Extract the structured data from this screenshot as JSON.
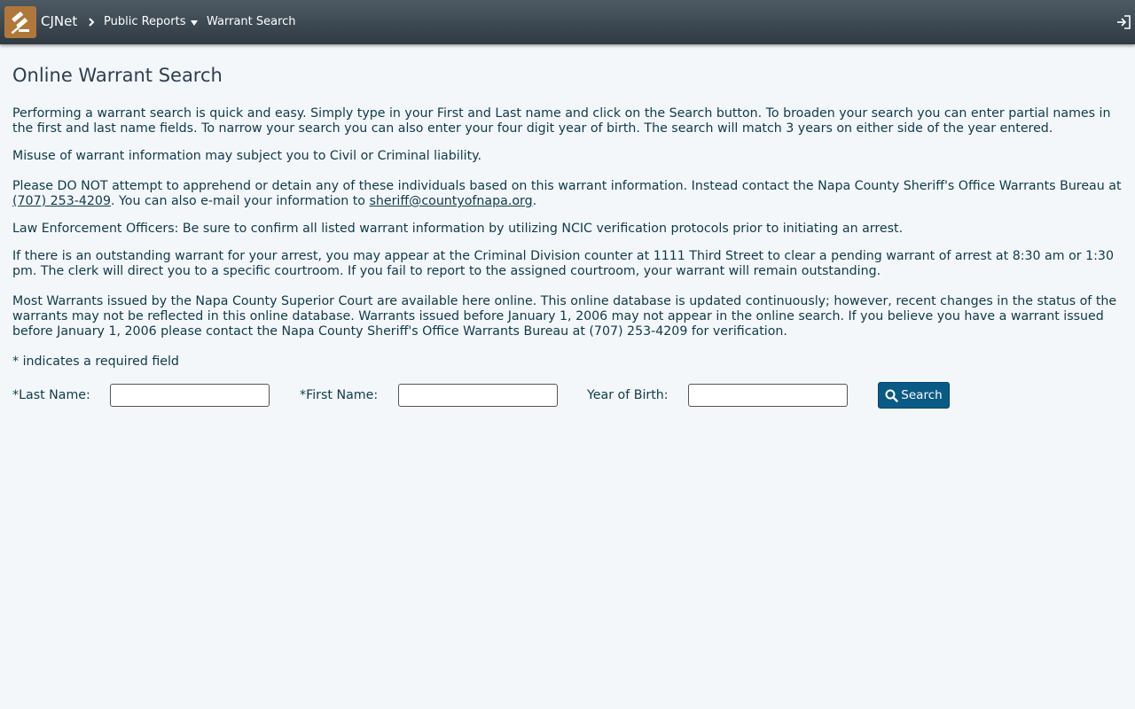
{
  "header": {
    "brand": "CJNet",
    "breadcrumb_reports": "Public Reports",
    "breadcrumb_current": "Warrant Search"
  },
  "page": {
    "title": "Online Warrant Search",
    "intro": "Performing a warrant search is quick and easy. Simply type in your First and Last name and click on the Search button. To broaden your search you can enter partial names in the first and last name fields. To narrow your search you can also enter your four digit year of birth. The search will match 3 years on either side of the year entered.",
    "misuse": "Misuse of warrant information may subject you to Civil or Criminal liability.",
    "contact_before": "Please DO NOT attempt to apprehend or detain any of these individuals based on this warrant information. Instead contact the Napa County Sheriff's Office Warrants Bureau at ",
    "contact_phone": "(707) 253-4209",
    "contact_middle": ". You can also e-mail your information to ",
    "contact_email": "sheriff@countyofnapa.org",
    "contact_after": ".",
    "law_enforcement": "Law Enforcement Officers: Be sure to confirm all listed warrant information by utilizing NCIC verification protocols prior to initiating an arrest.",
    "outstanding": "If there is an outstanding warrant for your arrest, you may appear at the Criminal Division counter at 1111 Third Street to clear a pending warrant of arrest at 8:30 am or 1:30 pm. The clerk will direct you to a specific courtroom. If you fail to report to the assigned courtroom, your warrant will remain outstanding.",
    "database": "Most Warrants issued by the Napa County Superior Court are available here online. This online database is updated continuously; however, recent changes in the status of the warrants may not be reflected in this online database. Warrants issued before January 1, 2006 may not appear in the online search. If you believe you have a warrant issued before January 1, 2006 please contact the Napa County Sheriff's Office Warrants Bureau at (707) 253-4209 for verification.",
    "required_note": "* indicates a required field"
  },
  "form": {
    "last_name_label": "*Last Name:",
    "last_name_value": "",
    "first_name_label": "*First Name:",
    "first_name_value": "",
    "yob_label": "Year of Birth:",
    "yob_value": "",
    "search_label": "Search"
  },
  "colors": {
    "header_bg": "#3b4750",
    "logo_bg": "#b0773a",
    "button_bg": "#0a5a86",
    "text": "#0e3a4a",
    "page_bg": "#f4f7fa"
  },
  "icons": {
    "logo": "gavel-icon",
    "separator": "chevron-right-icon",
    "dropdown": "caret-down-icon",
    "logout": "sign-out-icon",
    "search": "magnifier-icon"
  }
}
